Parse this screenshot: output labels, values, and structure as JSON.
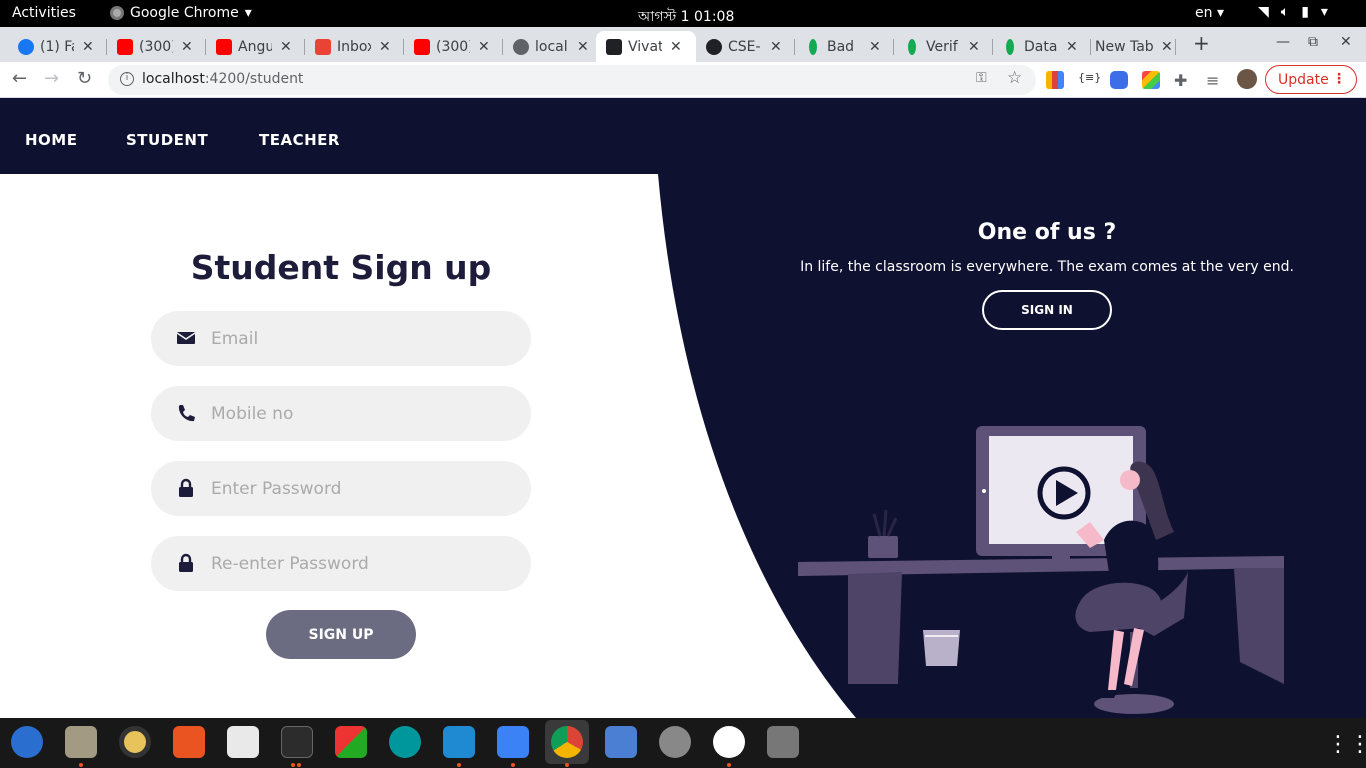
{
  "system_bar": {
    "activities": "Activities",
    "app_name": "Google Chrome",
    "clock": "আগস্ট 1  01:08",
    "language": "en"
  },
  "tabs": [
    {
      "title": "(1) Fa",
      "favicon": "facebook-icon",
      "color": "#1877f2"
    },
    {
      "title": "(300)",
      "favicon": "youtube-icon",
      "color": "#ff0000"
    },
    {
      "title": "Angu",
      "favicon": "youtube-icon",
      "color": "#ff0000"
    },
    {
      "title": "Inbox",
      "favicon": "gmail-icon",
      "color": "#ea4335"
    },
    {
      "title": "(300)",
      "favicon": "youtube-icon",
      "color": "#ff0000"
    },
    {
      "title": "local",
      "favicon": "globe-icon",
      "color": "#5f6368"
    },
    {
      "title": "Vivat",
      "favicon": "vivaldi-icon",
      "color": "#202124"
    },
    {
      "title": "CSE-",
      "favicon": "github-icon",
      "color": "#202124"
    },
    {
      "title": "Bad",
      "favicon": "mongodb-leaf-icon",
      "color": "#13aa52"
    },
    {
      "title": "Verif",
      "favicon": "mongodb-leaf-icon",
      "color": "#13aa52"
    },
    {
      "title": "Data",
      "favicon": "mongodb-leaf-icon",
      "color": "#13aa52"
    },
    {
      "title": "New Tab",
      "favicon": "",
      "color": ""
    }
  ],
  "address_bar": {
    "host": "localhost",
    "path": ":4200/student",
    "update_label": "Update"
  },
  "site_nav": {
    "home": "HOME",
    "student": "STUDENT",
    "teacher": "TEACHER"
  },
  "signup_form": {
    "title": "Student Sign up",
    "email_placeholder": "Email",
    "mobile_placeholder": "Mobile no",
    "password_placeholder": "Enter Password",
    "repassword_placeholder": "Re-enter Password",
    "submit_label": "SIGN UP"
  },
  "signin_panel": {
    "title": "One of us ?",
    "text": "In life, the classroom is everywhere. The exam comes at the very end.",
    "button_label": "SIGN IN"
  },
  "colors": {
    "navy": "#0f1130",
    "input_bg": "#f0f0f0",
    "button_gray": "#6b6b81",
    "accent_purple": "#6c5b8c"
  }
}
